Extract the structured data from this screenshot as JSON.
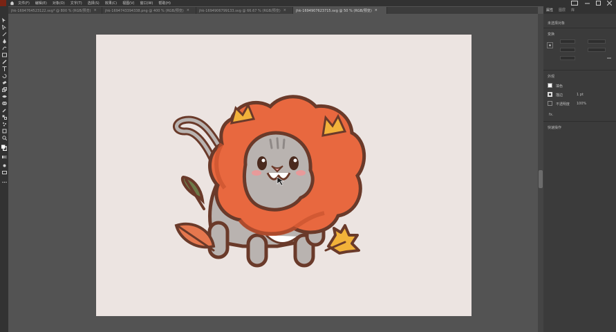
{
  "app": {
    "logo": "Ai"
  },
  "menu": [
    "文件(F)",
    "编辑(E)",
    "对象(O)",
    "文字(T)",
    "选择(S)",
    "效果(C)",
    "视图(V)",
    "窗口(W)",
    "帮助(H)"
  ],
  "tabs": [
    {
      "label": "jhk-1694764523122.svg* @ 800 % (RGB/预览)",
      "active": false
    },
    {
      "label": "jhk-1694743394338.png @ 400 % (RGB/预览)",
      "active": false
    },
    {
      "label": "jhk-1694906799133.svg @ 66.67 % (RGB/预览)",
      "active": false
    },
    {
      "label": "jhk-1694907623715.svg @ 50 % (RGB/预览)",
      "active": true
    }
  ],
  "panel": {
    "tabs": [
      "属性",
      "图层",
      "库"
    ],
    "selection": "未选择对象",
    "transform_title": "变换",
    "appearance_title": "外观",
    "fill_label": "填色",
    "stroke_label": "描边",
    "stroke_value": "1 pt",
    "opacity_label": "不透明度",
    "opacity_value": "100%",
    "fx_label": "fx.",
    "quick_actions_title": "快速操作"
  },
  "colors": {
    "chrome_dark": "#323232",
    "workspace": "#535353",
    "artboard": "#ece4e1",
    "outline": "#6a3a2a",
    "mane": "#e8683f",
    "fur": "#b9b3b0",
    "leaf_orange": "#e5774e",
    "leaf_yellow": "#f2b23a",
    "leaf_green": "#6d7a4a"
  },
  "icons": [
    "home-icon",
    "selection-tool-icon",
    "direct-selection-icon",
    "pen-tool-icon",
    "type-tool-icon",
    "rectangle-tool-icon",
    "zoom-tool-icon"
  ]
}
